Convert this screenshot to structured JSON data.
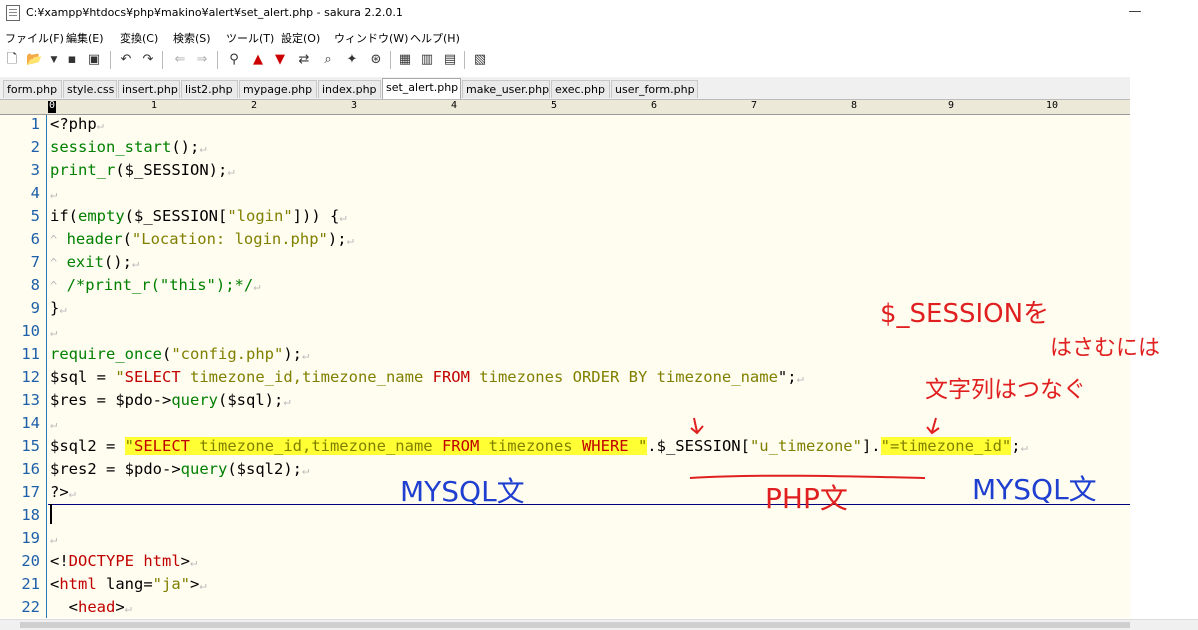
{
  "window": {
    "title": "C:¥xampp¥htdocs¥php¥makino¥alert¥set_alert.php - sakura 2.2.0.1",
    "minimize_symbol": "—"
  },
  "menu": [
    "ファイル(F)",
    "編集(E)",
    "変換(C)",
    "検索(S)",
    "ツール(T)",
    "設定(O)",
    "ウィンドウ(W)",
    "ヘルプ(H)"
  ],
  "tabs": [
    "form.php",
    "style.css",
    "insert.php",
    "list2.php",
    "mypage.php",
    "index.php",
    "set_alert.php",
    "make_user.php",
    "exec.php",
    "user_form.php"
  ],
  "active_tab": "set_alert.php",
  "ruler": {
    "cursor": "0",
    "marks": [
      "1",
      "2",
      "3",
      "4",
      "5",
      "6",
      "7",
      "8",
      "9",
      "10"
    ]
  },
  "line_numbers": [
    "1",
    "2",
    "3",
    "4",
    "5",
    "6",
    "7",
    "8",
    "9",
    "10",
    "11",
    "12",
    "13",
    "14",
    "15",
    "16",
    "17",
    "18",
    "19",
    "20",
    "21",
    "22"
  ],
  "code": {
    "l1": "<?php",
    "l2_fn": "session_start",
    "l2_rest": "();",
    "l3_fn": "print_r",
    "l3_rest": "($_SESSION);",
    "l5_a": "if(",
    "l5_fn": "empty",
    "l5_b": "($_SESSION[",
    "l5_str": "\"login\"",
    "l5_c": "])) {",
    "l6_fn": "header",
    "l6_a": "(",
    "l6_str": "\"Location: login.php\"",
    "l6_b": ");",
    "l7_fn": "exit",
    "l7_rest": "();",
    "l8": "/*print_r(\"this\");*/",
    "l9": "}",
    "l11_fn": "require_once",
    "l11_a": "(",
    "l11_str": "\"config.php\"",
    "l11_b": ");",
    "l12_a": "$sql = ",
    "l12_q": "\"",
    "l12_k1": "SELECT",
    "l12_m1": " timezone_id,timezone_name ",
    "l12_k2": "FROM",
    "l12_m2": " timezones ORDER BY timezone_name",
    "l12_end": "\";",
    "l13_a": "$res = $pdo->",
    "l13_fn": "query",
    "l13_b": "($sql);",
    "l15_a": "$sql2 = ",
    "l15_q1": "\"",
    "l15_k1": "SELECT",
    "l15_m1": " timezone_id,timezone_name ",
    "l15_k2": "FROM",
    "l15_m2": " timezones ",
    "l15_k3": "WHERE",
    "l15_q2": " \"",
    "l15_b": ".$_SESSION[",
    "l15_s": "\"u_timezone\"",
    "l15_c": "].",
    "l15_s2": "\"=timezone_id\"",
    "l15_d": ";",
    "l16_a": "$res2 = $pdo->",
    "l16_fn": "query",
    "l16_b": "($sql2);",
    "l17": "?>",
    "l20_a": "<!",
    "l20_k": "DOCTYPE html",
    "l20_b": ">",
    "l21_a": "<",
    "l21_k": "html",
    "l21_b": " lang=",
    "l21_s": "\"ja\"",
    "l21_c": ">",
    "l22_a": "  <",
    "l22_k": "head",
    "l22_b": ">",
    "eol": "↵",
    "tab_mark": "^"
  },
  "annotations": {
    "mysql1": "MYSQL文",
    "php": "PHP文",
    "mysql2": "MYSQL文",
    "note1": "$_SESSIONを",
    "note2": "はさむには",
    "note3": "文字列はつなぐ"
  },
  "colors": {
    "highlight": "#ffff33",
    "annotation_red": "#e02020",
    "annotation_blue": "#1f3fd0",
    "line_number": "#1d5fa8"
  }
}
